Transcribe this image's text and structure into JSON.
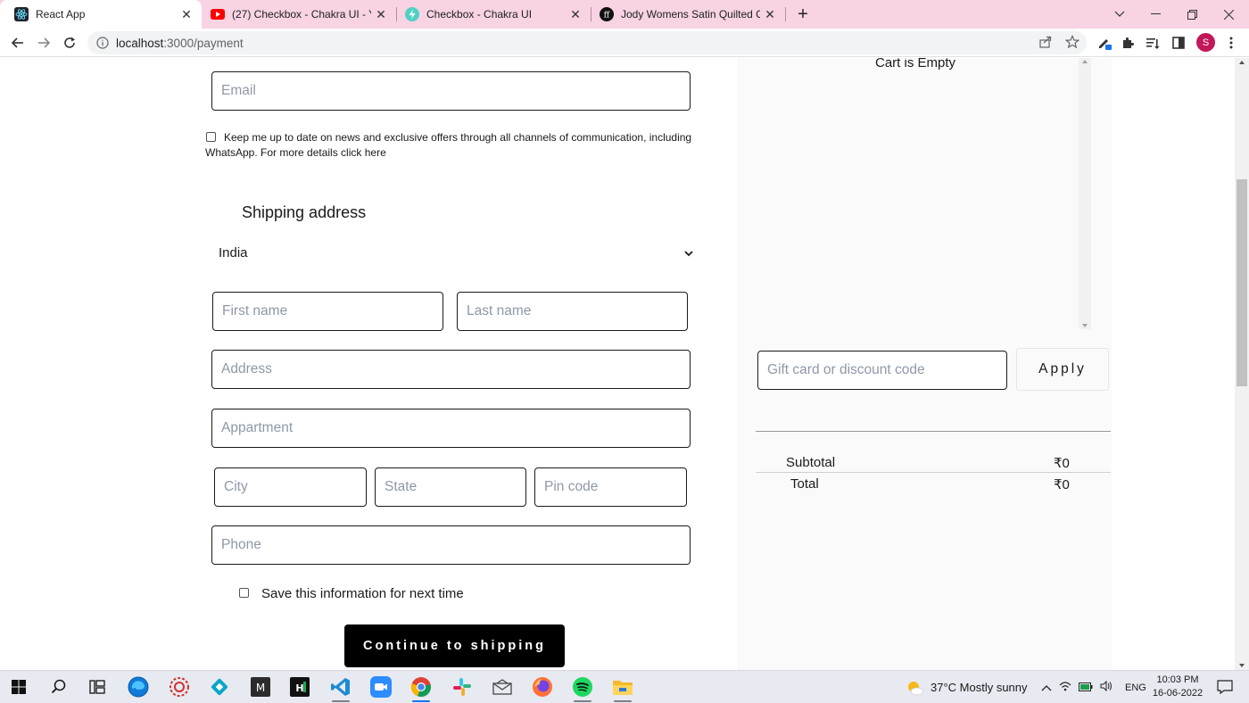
{
  "browser": {
    "tabs": [
      {
        "title": "React App",
        "active": true
      },
      {
        "title": "(27) Checkbox - Chakra UI - YouT",
        "active": false
      },
      {
        "title": "Checkbox - Chakra UI",
        "active": false
      },
      {
        "title": "Jody Womens Satin Quilted Casu",
        "active": false
      }
    ],
    "new_tab_label": "+",
    "url_host": "localhost",
    "url_path": ":3000/payment",
    "profile_initial": "S"
  },
  "form": {
    "email_placeholder": "Email",
    "newsletter_text": "Keep me up to date on news and exclusive offers through all channels of communication, including WhatsApp. For more details click here",
    "shipping_heading": "Shipping address",
    "country_value": "India",
    "first_name_placeholder": "First name",
    "last_name_placeholder": "Last name",
    "address_placeholder": "Address",
    "apartment_placeholder": "Appartment",
    "city_placeholder": "City",
    "state_placeholder": "State",
    "pin_placeholder": "Pin code",
    "phone_placeholder": "Phone",
    "save_info_text": "Save this information for next time",
    "continue_label": "Continue to shipping"
  },
  "summary": {
    "cart_empty_text": "Cart is Empty",
    "discount_placeholder": "Gift card or discount code",
    "apply_label": "Apply",
    "subtotal_label": "Subtotal",
    "subtotal_value": "₹0",
    "total_label": "Total",
    "total_value": "₹0"
  },
  "taskbar": {
    "weather": "37°C  Mostly sunny",
    "language": "ENG",
    "time": "10:03 PM",
    "date": "16-06-2022"
  },
  "colors": {
    "tabstrip": "#f7d3e4",
    "profile": "#c2185b",
    "panel": "#fafafa",
    "button": "#000000"
  }
}
